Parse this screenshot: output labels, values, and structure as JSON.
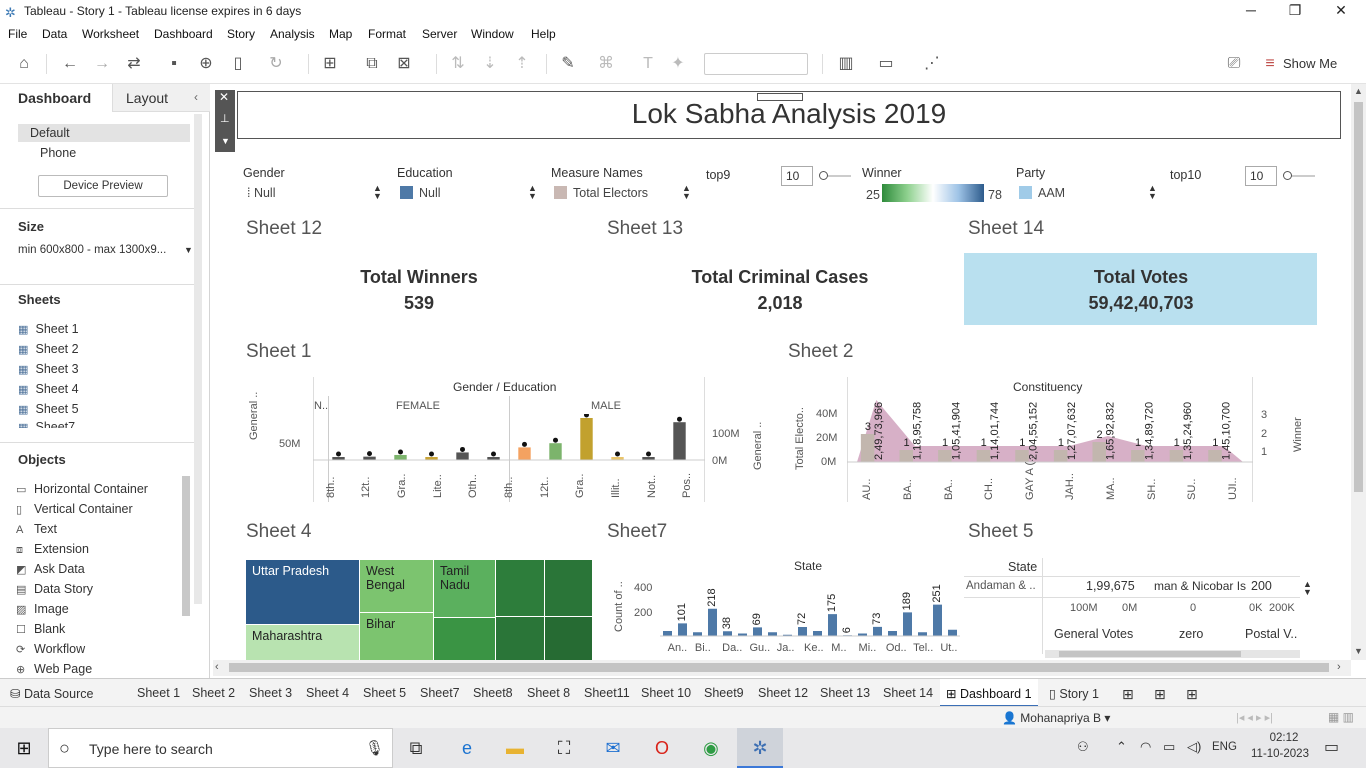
{
  "window": {
    "title": "Tableau - Story 1 - Tableau license expires in 6 days"
  },
  "menu": [
    "File",
    "Data",
    "Worksheet",
    "Dashboard",
    "Story",
    "Analysis",
    "Map",
    "Format",
    "Server",
    "Window",
    "Help"
  ],
  "toolbar": {
    "show_me": "Show Me"
  },
  "leftpane": {
    "tabs": {
      "dashboard": "Dashboard",
      "layout": "Layout"
    },
    "devices": [
      "Default",
      "Phone"
    ],
    "device_preview": "Device Preview",
    "size_label": "Size",
    "size_value": "min 600x800 - max 1300x9...",
    "sheets_label": "Sheets",
    "sheets": [
      "Sheet 1",
      "Sheet 2",
      "Sheet 3",
      "Sheet 4",
      "Sheet 5",
      "Sheet7"
    ],
    "objects_label": "Objects",
    "objects": [
      "Horizontal Container",
      "Vertical Container",
      "Text",
      "Extension",
      "Ask Data",
      "Data Story",
      "Image",
      "Blank",
      "Workflow",
      "Web Page"
    ]
  },
  "dashboard": {
    "title": "Lok Sabha Analysis 2019",
    "filters": {
      "gender": {
        "label": "Gender",
        "value": "Null"
      },
      "education": {
        "label": "Education",
        "value": "Null"
      },
      "measure_names": {
        "label": "Measure Names",
        "value": "Total Electors"
      },
      "top9": {
        "label": "top9",
        "value": "10"
      },
      "winner": {
        "label": "Winner",
        "min": "25",
        "max": "78"
      },
      "party": {
        "label": "Party",
        "value": "AAM"
      },
      "top10": {
        "label": "top10",
        "value": "10"
      }
    },
    "kpis": [
      {
        "sheet": "Sheet 12",
        "label": "Total Winners",
        "value": "539"
      },
      {
        "sheet": "Sheet 13",
        "label": "Total Criminal  Cases",
        "value": "2,018"
      },
      {
        "sheet": "Sheet 14",
        "label": "Total Votes",
        "value": "59,42,40,703"
      }
    ],
    "sheet1": {
      "title": "Sheet 1",
      "header": "Gender / Education",
      "groups": [
        "N..",
        "FEMALE",
        "MALE"
      ],
      "y_label": "General ..",
      "y_tick": "50M",
      "right_label": "General ..",
      "right_ticks": [
        "100M",
        "0M"
      ],
      "x_labels": [
        "8th..",
        "12t..",
        "Gra..",
        "Lite..",
        "Oth..",
        "8th..",
        "12t..",
        "Gra..",
        "Illit..",
        "Not..",
        "Pos.."
      ]
    },
    "sheet2": {
      "title": "Sheet 2",
      "header": "Constituency",
      "y_label": "Total Electo..",
      "y_ticks": [
        "40M",
        "20M",
        "0M"
      ],
      "right_label": "Winner",
      "right_ticks": [
        "3",
        "2",
        "1"
      ],
      "x_labels": [
        "AU..",
        "BA..",
        "BA..",
        "CH..",
        "GAY A (..",
        "JAH..",
        "MA..",
        "SH..",
        "SU..",
        "UJI.."
      ]
    },
    "sheet4": {
      "title": "Sheet 4",
      "cells": [
        "Uttar Pradesh",
        "West Bengal",
        "Tamil Nadu",
        "Maharashtra",
        "Bihar"
      ]
    },
    "sheet7": {
      "title": "Sheet7",
      "header": "State",
      "y_label": "Count of ..",
      "y_ticks": [
        "400",
        "200"
      ],
      "x_labels": [
        "An..",
        "Bi..",
        "Da..",
        "Gu..",
        "Ja..",
        "Ke..",
        "M..",
        "Mi..",
        "Od..",
        "Tel..",
        "Ut.."
      ]
    },
    "sheet5": {
      "title": "Sheet 5",
      "header": "State",
      "row_state": "Andaman & ..",
      "row_votes": "1,99,675",
      "row_text": "man & Nicobar Isl",
      "row_postal": "200",
      "axis1": [
        "100M",
        "0M"
      ],
      "axis2": "0",
      "axis3": [
        "0K",
        "200K"
      ],
      "col_labels": [
        "General Votes",
        "zero",
        "Postal V.."
      ]
    }
  },
  "chart_data": [
    {
      "type": "bar",
      "title": "Sheet 1",
      "categories": [
        "8th..",
        "12t..",
        "Gra..",
        "Lite..",
        "Oth..",
        "8th..",
        "12t..",
        "Gra..",
        "Illit..",
        "Not..",
        "Pos.."
      ],
      "ylabel": "General ..",
      "series": [
        {
          "values": [
            4,
            8,
            12,
            5,
            18,
            4,
            30,
            40,
            100,
            5,
            6,
            90
          ]
        }
      ]
    },
    {
      "type": "bar",
      "title": "Sheet 2",
      "categories": [
        "AU..",
        "BA..",
        "BA..",
        "CH..",
        "GAY A (..",
        "JAH..",
        "MA..",
        "SH..",
        "SU..",
        "UJI.."
      ],
      "ylabel": "Total Electo..",
      "ylim": [
        0,
        45
      ],
      "series": [
        {
          "name": "Winner",
          "values": [
            3,
            1,
            1,
            1,
            1,
            1,
            2,
            1,
            1,
            1
          ]
        }
      ],
      "data_labels": [
        "2,49,73,966",
        "1,18,95,758",
        "1,05,41,904",
        "1,14,01,744",
        "2,04,55,152",
        "1,27,07,632",
        "1,65,92,832",
        "1,34,89,720",
        "1,35,24,960",
        "1,45,10,700"
      ]
    },
    {
      "type": "bar",
      "title": "Sheet7",
      "ylabel": "Count of ..",
      "ylim": [
        0,
        400
      ],
      "values": [
        40,
        101,
        30,
        218,
        38,
        20,
        69,
        30,
        10,
        72,
        40,
        175,
        6,
        20,
        73,
        40,
        189,
        30,
        251,
        50
      ],
      "data_labels": [
        "101",
        "218",
        "38",
        "69",
        "72",
        "175",
        "6",
        "73",
        "189",
        "251"
      ]
    }
  ]
}
